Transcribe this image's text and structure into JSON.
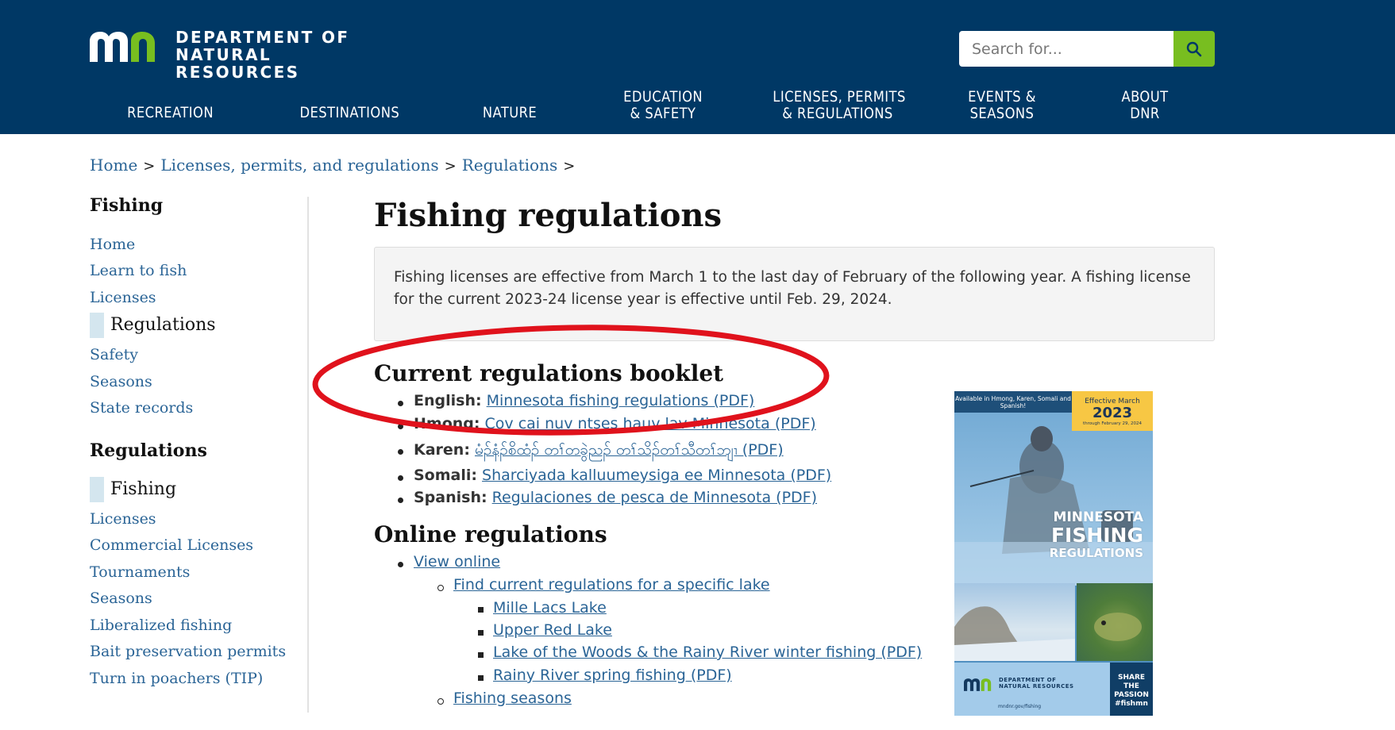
{
  "header": {
    "logo_line1": "DEPARTMENT OF",
    "logo_line2": "NATURAL RESOURCES",
    "search_placeholder": "Search for...",
    "colors": {
      "header_bg": "#003865",
      "search_button": "#78be20",
      "logo_green": "#78be20"
    }
  },
  "nav": [
    {
      "line1": "RECREATION",
      "line2": ""
    },
    {
      "line1": "DESTINATIONS",
      "line2": ""
    },
    {
      "line1": "NATURE",
      "line2": ""
    },
    {
      "line1": "EDUCATION",
      "line2": "& SAFETY"
    },
    {
      "line1": "LICENSES, PERMITS",
      "line2": "& REGULATIONS"
    },
    {
      "line1": "EVENTS &",
      "line2": "SEASONS"
    },
    {
      "line1": "ABOUT",
      "line2": "DNR"
    }
  ],
  "breadcrumb": [
    "Home",
    "Licenses, permits, and regulations",
    "Regulations"
  ],
  "breadcrumb_sep": ">",
  "sidebar": {
    "section1_title": "Fishing",
    "section1_items": [
      "Home",
      "Learn to fish",
      "Licenses",
      "Regulations",
      "Safety",
      "Seasons",
      "State records"
    ],
    "section1_active": "Regulations",
    "section2_title": "Regulations",
    "section2_items": [
      "Fishing",
      "Licenses",
      "Commercial Licenses",
      "Tournaments",
      "Seasons",
      "Liberalized fishing",
      "Bait preservation permits",
      "Turn in poachers (TIP)"
    ],
    "section2_active": "Fishing"
  },
  "main": {
    "title": "Fishing regulations",
    "notice": "Fishing licenses are effective from March 1 to the last day of February of the following year. A fishing license for the current 2023-24 license year is effective until Feb. 29, 2024.",
    "booklet_heading": "Current regulations booklet",
    "booklet_items": [
      {
        "lang": "English:",
        "link": "Minnesota fishing regulations (PDF)"
      },
      {
        "lang": "Hmong:",
        "link": "Cov cai nuv ntses hauv lav Minnesota (PDF)"
      },
      {
        "lang": "Karen:",
        "link": "မံၣ်နံၣ်စိထံၣ် တၢ်တခွဲညၣ် တၢ်သိၣ်တၢ်သီတၢ်ဘျၢ (PDF)"
      },
      {
        "lang": "Somali:",
        "link": "Sharciyada kalluumeysiga ee Minnesota (PDF)"
      },
      {
        "lang": "Spanish:",
        "link": "Regulaciones de pesca de Minnesota (PDF)"
      }
    ],
    "online_heading": "Online regulations",
    "online_view": "View online",
    "online_find": "Find current regulations for a specific lake",
    "online_lakes": [
      "Mille Lacs Lake",
      "Upper Red Lake",
      "Lake of the Woods & the Rainy River winter fishing (PDF)",
      "Rainy River spring fishing (PDF)"
    ],
    "online_seasons": "Fishing seasons",
    "link_color": "#2a6496",
    "annotation_color": "#e0121c"
  },
  "cover": {
    "banner": "Available in Hmong, Karen, Somali and Spanish!",
    "badge_line1": "Effective March",
    "badge_year": "2023",
    "badge_line3": "through February 29, 2024",
    "title1": "MINNESOTA",
    "title2": "FISHING",
    "title3": "REGULATIONS",
    "dnr_line1": "DEPARTMENT OF",
    "dnr_line2": "NATURAL RESOURCES",
    "url": "mndnr.gov/fishing",
    "share1": "SHARE",
    "share2": "THE",
    "share3": "PASSION",
    "share4": "#fishmn"
  }
}
